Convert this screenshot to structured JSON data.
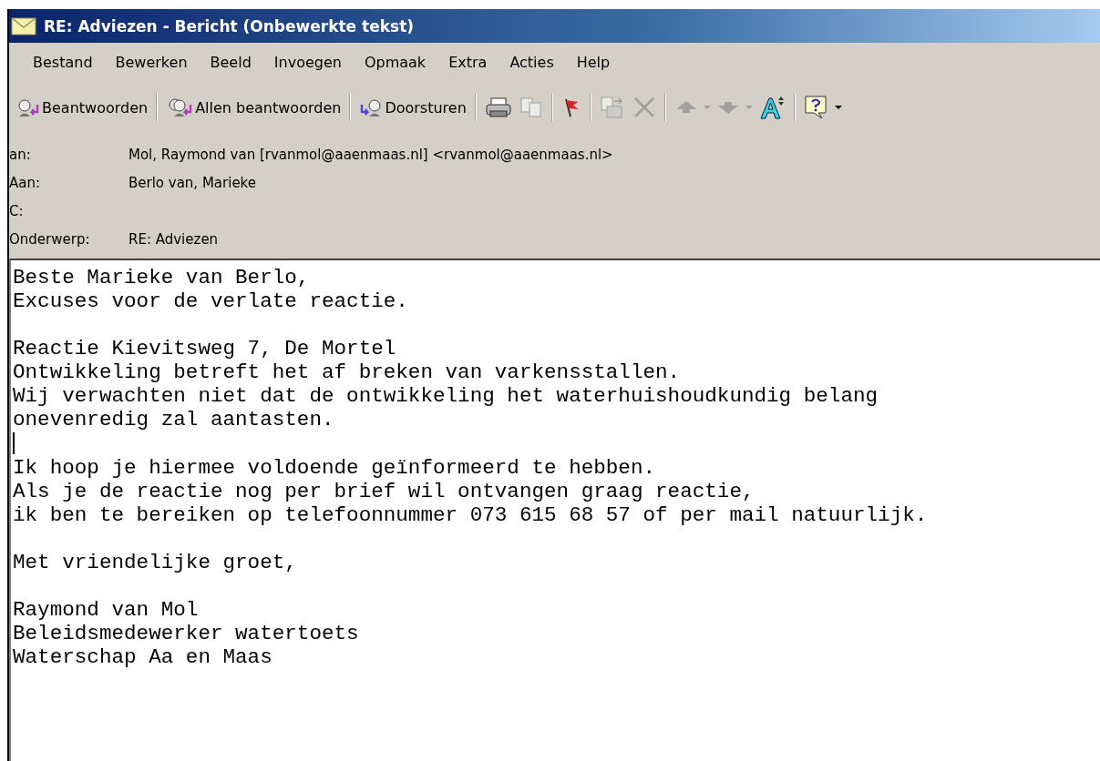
{
  "window": {
    "title": "RE: Adviezen - Bericht (Onbewerkte tekst)"
  },
  "menu": [
    "Bestand",
    "Bewerken",
    "Beeld",
    "Invoegen",
    "Opmaak",
    "Extra",
    "Acties",
    "Help"
  ],
  "toolbar": [
    {
      "kind": "text",
      "label": "Beantwoorden"
    },
    {
      "kind": "separator"
    },
    {
      "kind": "text",
      "label": "Allen beantwoorden"
    },
    {
      "kind": "separator"
    },
    {
      "kind": "text",
      "label": "Doorsturen"
    },
    {
      "kind": "separator"
    },
    {
      "kind": "icon",
      "disabled": false
    },
    {
      "kind": "icon",
      "disabled": true
    },
    {
      "kind": "separator"
    },
    {
      "kind": "icon",
      "disabled": false
    },
    {
      "kind": "separator"
    },
    {
      "kind": "icon",
      "disabled": true
    },
    {
      "kind": "icon",
      "disabled": true
    },
    {
      "kind": "separator"
    },
    {
      "kind": "icon",
      "disabled": true
    },
    {
      "kind": "dropdown",
      "disabled": true
    },
    {
      "kind": "icon",
      "disabled": true
    },
    {
      "kind": "dropdown",
      "disabled": true
    },
    {
      "kind": "icon",
      "disabled": false
    },
    {
      "kind": "separator"
    },
    {
      "kind": "icon",
      "disabled": false
    },
    {
      "kind": "dropdown",
      "disabled": false
    }
  ],
  "headers": [
    {
      "label": "an:",
      "value": "Mol, Raymond van [rvanmol@aaenmaas.nl] <rvanmol@aaenmaas.nl>"
    },
    {
      "label": "Aan:",
      "value": "Berlo van, Marieke"
    },
    {
      "label": "C:"
    },
    {
      "label": "Onderwerp:",
      "value": "RE: Adviezen"
    }
  ],
  "body": [
    {
      "lines": [
        "Beste Marieke van Berlo,",
        "Excuses voor de verlate reactie."
      ]
    },
    {
      "lines": [
        "Reactie Kievitsweg 7, De Mortel",
        "Ontwikkeling betreft het af breken van varkensstallen.",
        "Wij verwachten niet dat de ontwikkeling het waterhuishoudkundig belang",
        "onevenredig zal aantasten."
      ],
      "cursor_after": true
    },
    {
      "lines": [
        "Ik hoop je hiermee voldoende geïnformeerd te hebben.",
        "Als je de reactie nog per brief wil ontvangen graag reactie,",
        "ik ben te bereiken op telefoonnummer 073 615 68 57 of per mail natuurlijk."
      ]
    },
    {
      "lines": [
        "Met vriendelijke groet,"
      ]
    },
    {
      "lines": [
        "Raymond van Mol",
        "Beleidsmedewerker watertoets",
        "Waterschap Aa en Maas"
      ]
    }
  ]
}
